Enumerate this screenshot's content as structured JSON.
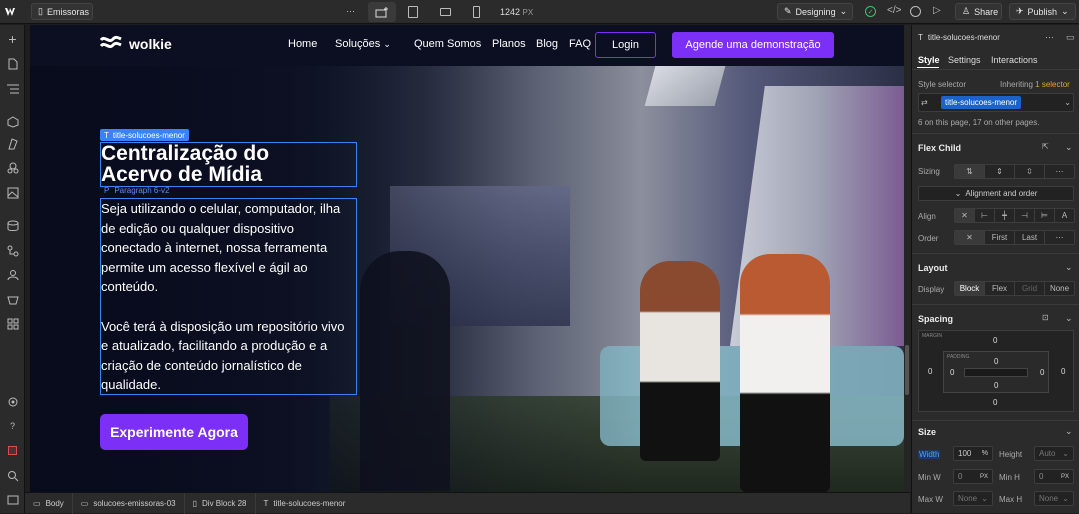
{
  "topbar": {
    "page_name": "Emissoras",
    "more": "···",
    "width_value": "1242",
    "width_unit": "PX",
    "mode": "Designing",
    "share": "Share",
    "publish": "Publish"
  },
  "site": {
    "logo": "wolkie",
    "nav": [
      "Home",
      "Soluções",
      "Quem Somos",
      "Planos",
      "Blog",
      "FAQ"
    ],
    "login": "Login",
    "cta_nav": "Agende uma demonstração",
    "tag_title": "title-solucoes-menor",
    "title_line1": "Centralização do",
    "title_line2": "Acervo de Mídia",
    "tag_paragraph": "Paragraph 6-v2",
    "para1": [
      "Seja utilizando o celular, computador, ilha",
      "de edição ou qualquer dispositivo",
      "conectado à internet, nossa ferramenta",
      "permite um acesso flexível e ágil ao",
      "conteúdo."
    ],
    "para2": [
      "Você terá à disposição um repositório vivo",
      "e atualizado, facilitando a produção e a",
      "criação de conteúdo jornalístico de",
      "qualidade."
    ],
    "cta_hero": "Experimente Agora"
  },
  "panel": {
    "element_name": "title-solucoes-menor",
    "tabs": [
      "Style",
      "Settings",
      "Interactions"
    ],
    "style_selector_label": "Style selector",
    "inheriting": "Inheriting",
    "inheriting_count": "1 selector",
    "selector": "title-solucoes-menor",
    "usage_note": "6 on this page, 17 on other pages.",
    "flex_child": "Flex Child",
    "sizing": "Sizing",
    "align_order_btn": "Alignment and order",
    "align": "Align",
    "order": "Order",
    "order_first": "First",
    "order_last": "Last",
    "layout": "Layout",
    "display": "Display",
    "display_opts": [
      "Block",
      "Flex",
      "Grid",
      "None"
    ],
    "spacing": "Spacing",
    "margin_label": "MARGIN",
    "padding_label": "PADDING",
    "zero": "0",
    "size": "Size",
    "width": "Width",
    "width_val": "100",
    "width_unit": "%",
    "height": "Height",
    "height_val": "Auto",
    "minw": "Min W",
    "minw_val": "0",
    "minh": "Min H",
    "minh_val": "0",
    "px": "PX",
    "maxw": "Max W",
    "maxw_val": "None",
    "maxh": "Max H",
    "maxh_val": "None"
  },
  "breadcrumbs": [
    "Body",
    "solucoes-emissoras-03",
    "Div Block 28",
    "title-solucoes-menor"
  ],
  "colors": {
    "accent_purple": "#7b2ff7",
    "selection_blue": "#3b82f6",
    "selector_blue": "#1b63c9"
  }
}
